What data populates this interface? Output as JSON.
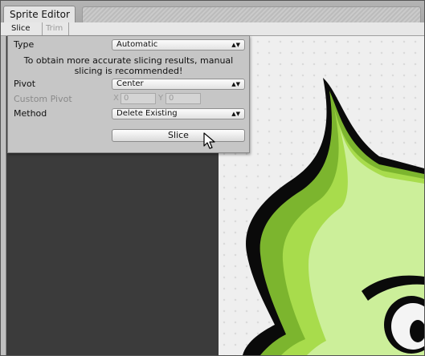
{
  "window": {
    "tab_title": "Sprite Editor"
  },
  "toolbar": {
    "slice_label": "Slice ÷",
    "trim_label": "Trim"
  },
  "slice_panel": {
    "type_label": "Type",
    "type_value": "Automatic",
    "note": "To obtain more accurate slicing results, manual slicing is recommended!",
    "pivot_label": "Pivot",
    "pivot_value": "Center",
    "custom_pivot_label": "Custom Pivot",
    "x_label": "X",
    "x_value": "0",
    "y_label": "Y",
    "y_value": "0",
    "method_label": "Method",
    "method_value": "Delete Existing",
    "slice_button": "Slice",
    "dropdown_arrow": "▲▼"
  },
  "colors": {
    "sprite_outline": "#0a0a0a",
    "sprite_green_dark": "#7cb52e",
    "sprite_green_mid": "#a8dc4c",
    "sprite_green_light": "#ccef9a",
    "canvas_dark": "#3b3b3b"
  }
}
